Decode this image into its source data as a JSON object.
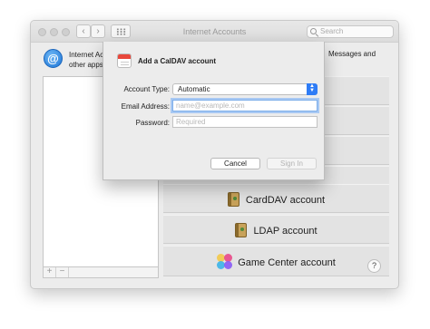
{
  "window": {
    "title": "Internet Accounts",
    "search_placeholder": "Search",
    "nav_back": "‹",
    "nav_forward": "›"
  },
  "header": {
    "description_left_line1": "Internet Ac",
    "description_left_line2": "other apps",
    "description_right": "Messages and"
  },
  "list_controls": {
    "add_label": "+",
    "remove_label": "−"
  },
  "providers": [
    {
      "label": "CardDAV account",
      "icon": "carddav-icon"
    },
    {
      "label": "LDAP account",
      "icon": "ldap-icon"
    },
    {
      "label": "Game Center account",
      "icon": "game-center-icon"
    }
  ],
  "help_label": "?",
  "sheet": {
    "title": "Add a CalDAV account",
    "account_type_label": "Account Type:",
    "account_type_value": "Automatic",
    "email_label": "Email Address:",
    "email_placeholder": "name@example.com",
    "password_label": "Password:",
    "password_placeholder": "Required",
    "cancel_label": "Cancel",
    "signin_label": "Sign In"
  },
  "colors": {
    "accent": "#2e7cf6",
    "focus_ring": "#a9c9f3"
  }
}
